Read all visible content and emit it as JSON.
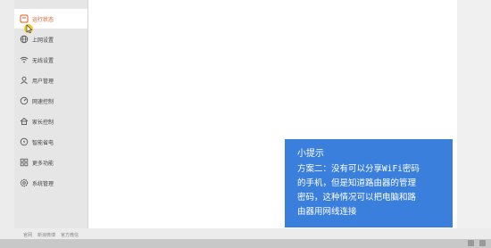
{
  "sidebar": {
    "items": [
      {
        "label": "运行状态",
        "icon": "status-monitor-icon",
        "active": true
      },
      {
        "label": "上网设置",
        "icon": "globe-icon"
      },
      {
        "label": "无线设置",
        "icon": "wifi-icon"
      },
      {
        "label": "用户管理",
        "icon": "user-icon"
      },
      {
        "label": "网速控制",
        "icon": "speed-gauge-icon"
      },
      {
        "label": "家长控制",
        "icon": "house-icon"
      },
      {
        "label": "智能省电",
        "icon": "power-icon"
      },
      {
        "label": "更多功能",
        "icon": "grid-icon"
      },
      {
        "label": "系统管理",
        "icon": "gear-icon"
      }
    ]
  },
  "footer": {
    "links": [
      "官网",
      "新浪微博",
      "官方微信"
    ]
  },
  "tip": {
    "title": "小提示",
    "body": "方案二：没有可以分享WiFi密码\n的手机，但是知道路由器的管理\n密码，这种情况可以把电脑和路\n由器用网线连接"
  },
  "colors": {
    "accent": "#e05a1a",
    "tip_bg": "#3a7fdb",
    "cursor": "#f2c200"
  }
}
